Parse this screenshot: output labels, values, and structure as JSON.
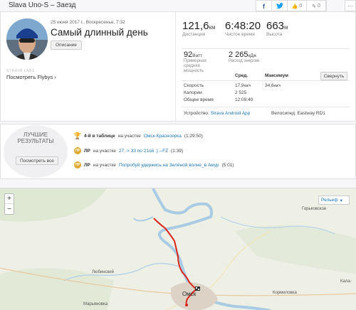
{
  "header": {
    "title": "Slava Uno-S – Заезд",
    "share": {
      "facebook": "f",
      "twitter": "t"
    },
    "kudos_count": "0",
    "comments_count": "0",
    "more": "···"
  },
  "activity": {
    "date": "25 июня 2017 г., Воскресенье, 7:32",
    "name": "Самый длинный день",
    "description_button": "Описание",
    "labs": "STRAVA LABS",
    "flyby_link": "Посмотреть Flybys"
  },
  "stats": {
    "distance": {
      "value": "121,6",
      "unit": "км",
      "label": "Дистанция"
    },
    "moving_time": {
      "value": "6:48:20",
      "label": "Чистое время"
    },
    "elevation": {
      "value": "663",
      "unit": "м",
      "label": "Высота"
    },
    "power": {
      "value": "92",
      "unit": "Ватт",
      "label_1": "Примерная",
      "label_2": "средняя",
      "label_3": "мощность"
    },
    "energy": {
      "value": "2 265",
      "unit": "кДж",
      "label": "Расход энергии"
    }
  },
  "details": {
    "col_avg": "Сред.",
    "col_max": "Максимум",
    "collapse_button": "Свернуть",
    "rows": [
      {
        "label": "Скорость",
        "avg": "17,9",
        "avg_unit": "км/ч",
        "max": "34,6",
        "max_unit": "км/ч"
      },
      {
        "label": "Калории",
        "avg": "2 525",
        "avg_unit": "",
        "max": "",
        "max_unit": ""
      },
      {
        "label": "Общее время",
        "avg": "12:09:40",
        "avg_unit": "",
        "max": "",
        "max_unit": ""
      }
    ],
    "device_label": "Устройство:",
    "device_value": "Strava Android App",
    "bike_label": "Велосипед:",
    "bike_value": "Eastway RD1"
  },
  "results": {
    "title_1": "ЛУЧШИЕ",
    "title_2": "РЕЗУЛЬТАТЫ",
    "button": "Посмотреть все",
    "items": [
      {
        "icon": "trophy-icon",
        "badge": "",
        "strong": "4-й в таблице",
        "text": "на участке",
        "link": "Омск-Красноярка",
        "suffix": "(1:29:50)"
      },
      {
        "icon": "pr-medal-icon",
        "badge": "ЛР",
        "strong": "ЛР",
        "text": "на участке",
        "link": "27 -> 33 по 21ой :) --FZ",
        "suffix": "(1:39)"
      },
      {
        "icon": "pr-medal-icon",
        "badge": "ЛР",
        "strong": "ЛР",
        "text": "на участке",
        "link": "Попробуй удержись на Зелёной волне_в Амур",
        "suffix": "(5:01)"
      }
    ]
  },
  "map": {
    "zoom_in": "+",
    "zoom_out": "−",
    "layer_select": "Рельеф",
    "labels": {
      "gorkovskoe": "Горьковское",
      "lyubinsky": "Любинский",
      "omsk": "Омск",
      "kormilovka": "Кормиловка",
      "maryanovka": "Марьяновка",
      "kala": "Кала-"
    }
  },
  "colors": {
    "route": "#d9261c",
    "link": "#1c79b7",
    "gold": "#e0a82e",
    "water": "#a9cbe4"
  }
}
